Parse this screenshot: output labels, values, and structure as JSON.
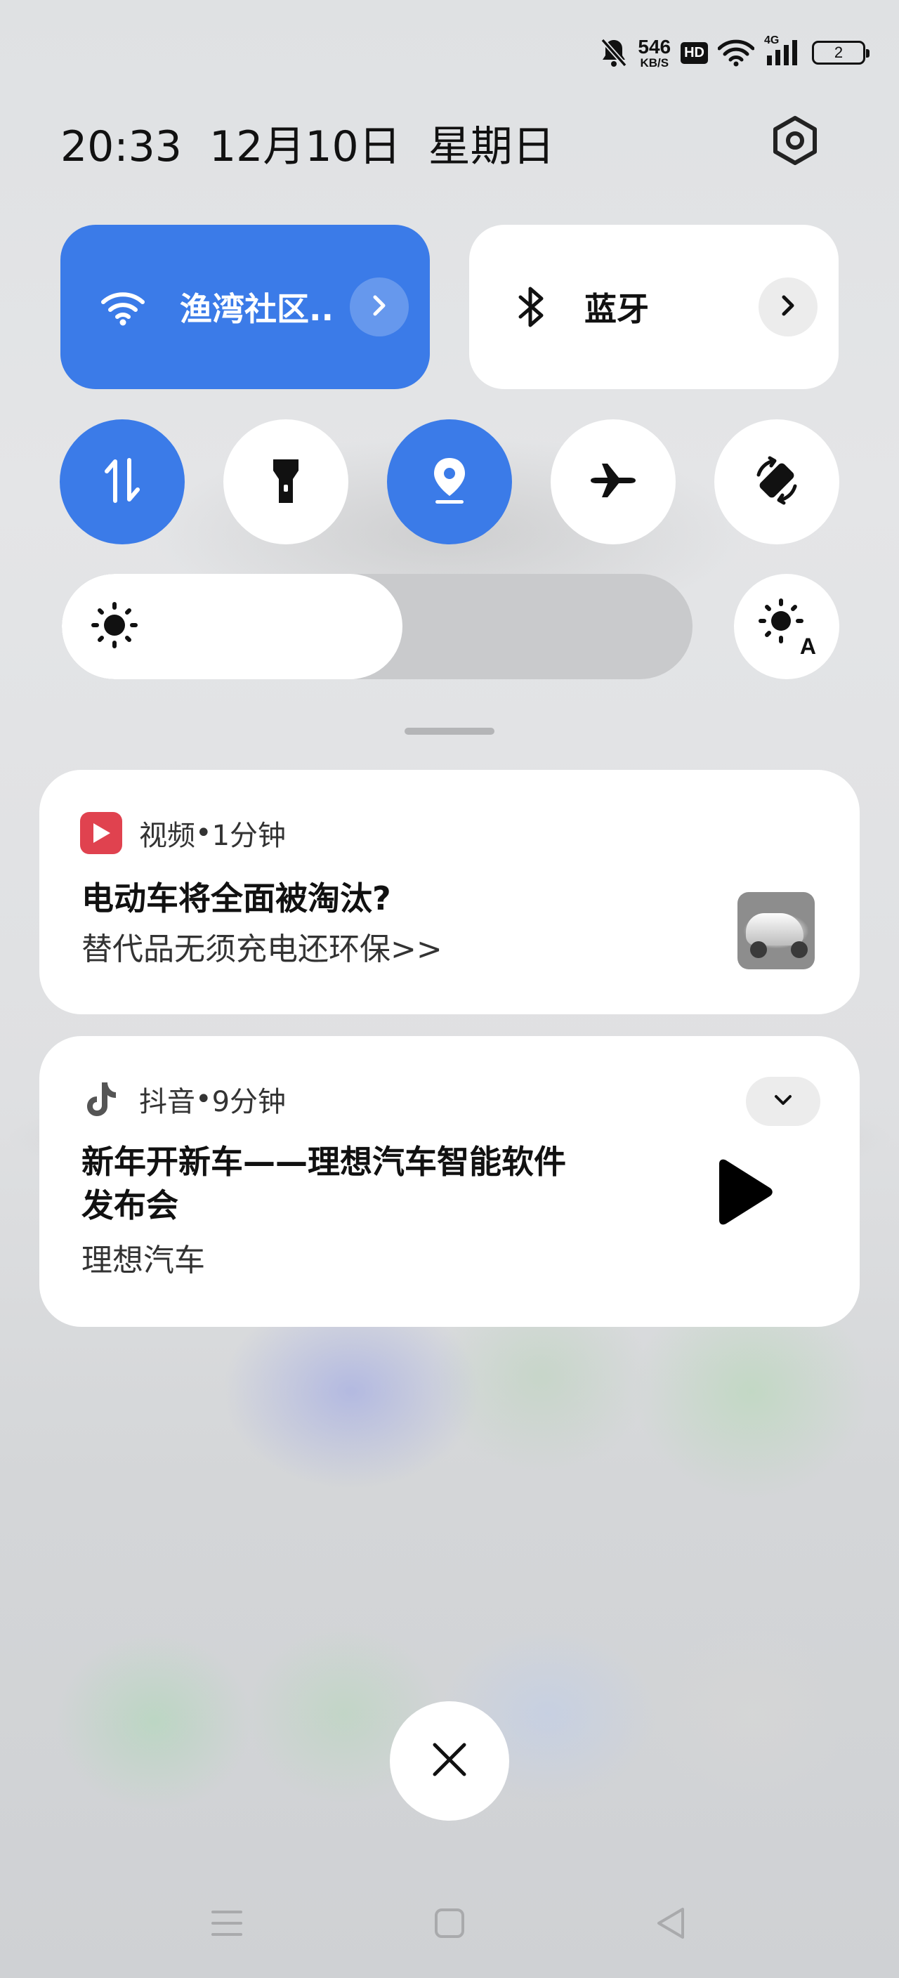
{
  "status_bar": {
    "net_speed_value": "546",
    "net_speed_unit": "KB/S",
    "hd_label": "HD",
    "network_type": "4G",
    "battery_level": "2",
    "icons": [
      "bell-muted-icon",
      "wifi-icon",
      "signal-icon",
      "battery-icon"
    ]
  },
  "header": {
    "time": "20:33",
    "date": "12月10日",
    "weekday": "星期日"
  },
  "quick_tiles": {
    "wifi": {
      "label": "渔湾社区..",
      "active": true
    },
    "bluetooth": {
      "label": "蓝牙",
      "active": false
    }
  },
  "toggles": [
    {
      "name": "mobile-data",
      "icon": "data-transfer-icon",
      "active": true
    },
    {
      "name": "flashlight",
      "icon": "flashlight-icon",
      "active": false
    },
    {
      "name": "location",
      "icon": "location-icon",
      "active": true
    },
    {
      "name": "airplane-mode",
      "icon": "airplane-icon",
      "active": false
    },
    {
      "name": "auto-rotate",
      "icon": "rotate-icon",
      "active": false
    }
  ],
  "brightness": {
    "level": 0.54,
    "auto_label": "A"
  },
  "notifications": [
    {
      "app": "视频",
      "time": "1分钟",
      "title": "电动车将全面被淘汰?",
      "body": "替代品无须充电还环保>>"
    },
    {
      "app": "抖音",
      "time": "9分钟",
      "title": "新年开新车——理想汽车智能软件发布会",
      "body": "理想汽车"
    }
  ],
  "separator": " • ",
  "colors": {
    "accent": "#3b7be8",
    "tile_inactive": "#ffffff",
    "video_app": "#e0424f"
  }
}
